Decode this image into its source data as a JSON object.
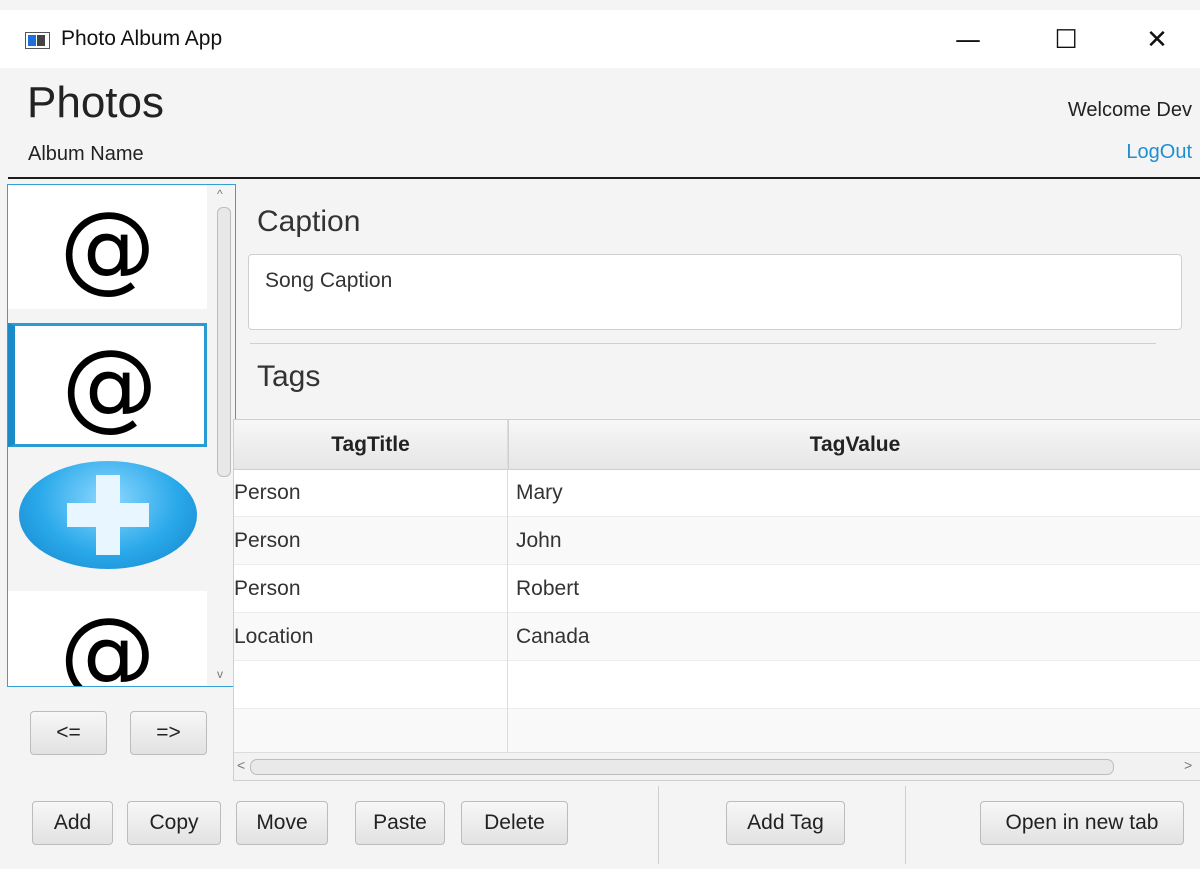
{
  "window": {
    "title": "Photo Album App",
    "controls": {
      "minimize": "—",
      "maximize": "☐",
      "close": "✕"
    }
  },
  "header": {
    "title": "Photos",
    "album_name": "Album Name",
    "welcome": "Welcome Dev",
    "logout": "LogOut"
  },
  "thumbnails": {
    "items": [
      {
        "type": "at-symbol",
        "glyph": "@",
        "selected": false
      },
      {
        "type": "at-symbol",
        "glyph": "@",
        "selected": true
      },
      {
        "type": "plus-icon",
        "glyph": "",
        "selected": false
      },
      {
        "type": "at-symbol",
        "glyph": "@",
        "selected": false
      }
    ],
    "prev_label": "<=",
    "next_label": "=>",
    "scroll_up": "^",
    "scroll_down": "v"
  },
  "caption": {
    "label": "Caption",
    "value": "Song Caption"
  },
  "tags": {
    "label": "Tags",
    "columns": [
      "TagTitle",
      "TagValue"
    ],
    "rows": [
      {
        "title": "Person",
        "value": "Mary"
      },
      {
        "title": "Person",
        "value": "John"
      },
      {
        "title": "Person",
        "value": "Robert"
      },
      {
        "title": "Location",
        "value": "Canada"
      }
    ],
    "scroll_left": "<",
    "scroll_right": ">"
  },
  "actions": {
    "add": "Add",
    "copy": "Copy",
    "move": "Move",
    "paste": "Paste",
    "delete": "Delete",
    "add_tag": "Add Tag",
    "open_new_tab": "Open in new tab"
  },
  "colors": {
    "accent": "#2b9bd3",
    "link": "#1e8fd0",
    "background": "#f4f4f4"
  }
}
